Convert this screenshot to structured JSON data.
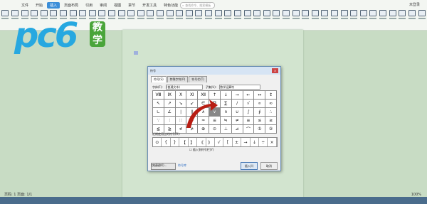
{
  "menubar": {
    "items": [
      "文件",
      "开始",
      "插入",
      "页面布局",
      "引用",
      "审阅",
      "视图",
      "章节",
      "开发工具",
      "特色功能"
    ],
    "active_index": 2
  },
  "search": {
    "placeholder": "查找命令、搜索模板"
  },
  "window_controls": {
    "user_label": "未登录"
  },
  "logo": {
    "text": "pc6",
    "badge": "教学"
  },
  "dialog": {
    "title": "符号",
    "close_glyph": "×",
    "tabs": [
      "符号(S)",
      "特殊字符(P)",
      "符号栏(T)"
    ],
    "font_label": "字体(F):",
    "font_value": "(普通文本)",
    "subset_label": "子集(U):",
    "subset_value": "数学运算符",
    "symbols": [
      "Ⅷ",
      "Ⅸ",
      "Ⅹ",
      "Ⅺ",
      "Ⅻ",
      "↑",
      "↓",
      "→",
      "←",
      "↔",
      "↕",
      "↖",
      "↗",
      "↘",
      "↙",
      "∈",
      "∏",
      "∑",
      "∕",
      "√",
      "∝",
      "∞",
      "∟",
      "∠",
      "∣",
      "∥",
      "∧",
      "∨",
      "∩",
      "∪",
      "∫",
      "∮",
      "∴",
      "∵",
      "∶",
      "∷",
      "∽",
      "≈",
      "≌",
      "≒",
      "≠",
      "≡",
      "≤",
      "≥",
      "≦",
      "≧",
      "≮",
      "≯",
      "⊕",
      "⊙",
      "⊥",
      "⊿",
      "⌒",
      "①",
      "②"
    ],
    "highlight_index": 27,
    "recent_label": "近期使用过的符号(R):",
    "recent": [
      "⊙",
      "{",
      "}",
      "【",
      "】",
      "《",
      "》",
      "√",
      "[",
      "±",
      "→",
      "↓",
      "÷",
      "×"
    ],
    "checkbox_label": "插入到符号栏(Y)",
    "shortcut_button": "快捷键(K)...",
    "link_text": "符号库",
    "ok": "插入(I)",
    "cancel": "取消"
  },
  "status": {
    "left": "页码: 1  页面: 1/1",
    "right": "100%"
  }
}
